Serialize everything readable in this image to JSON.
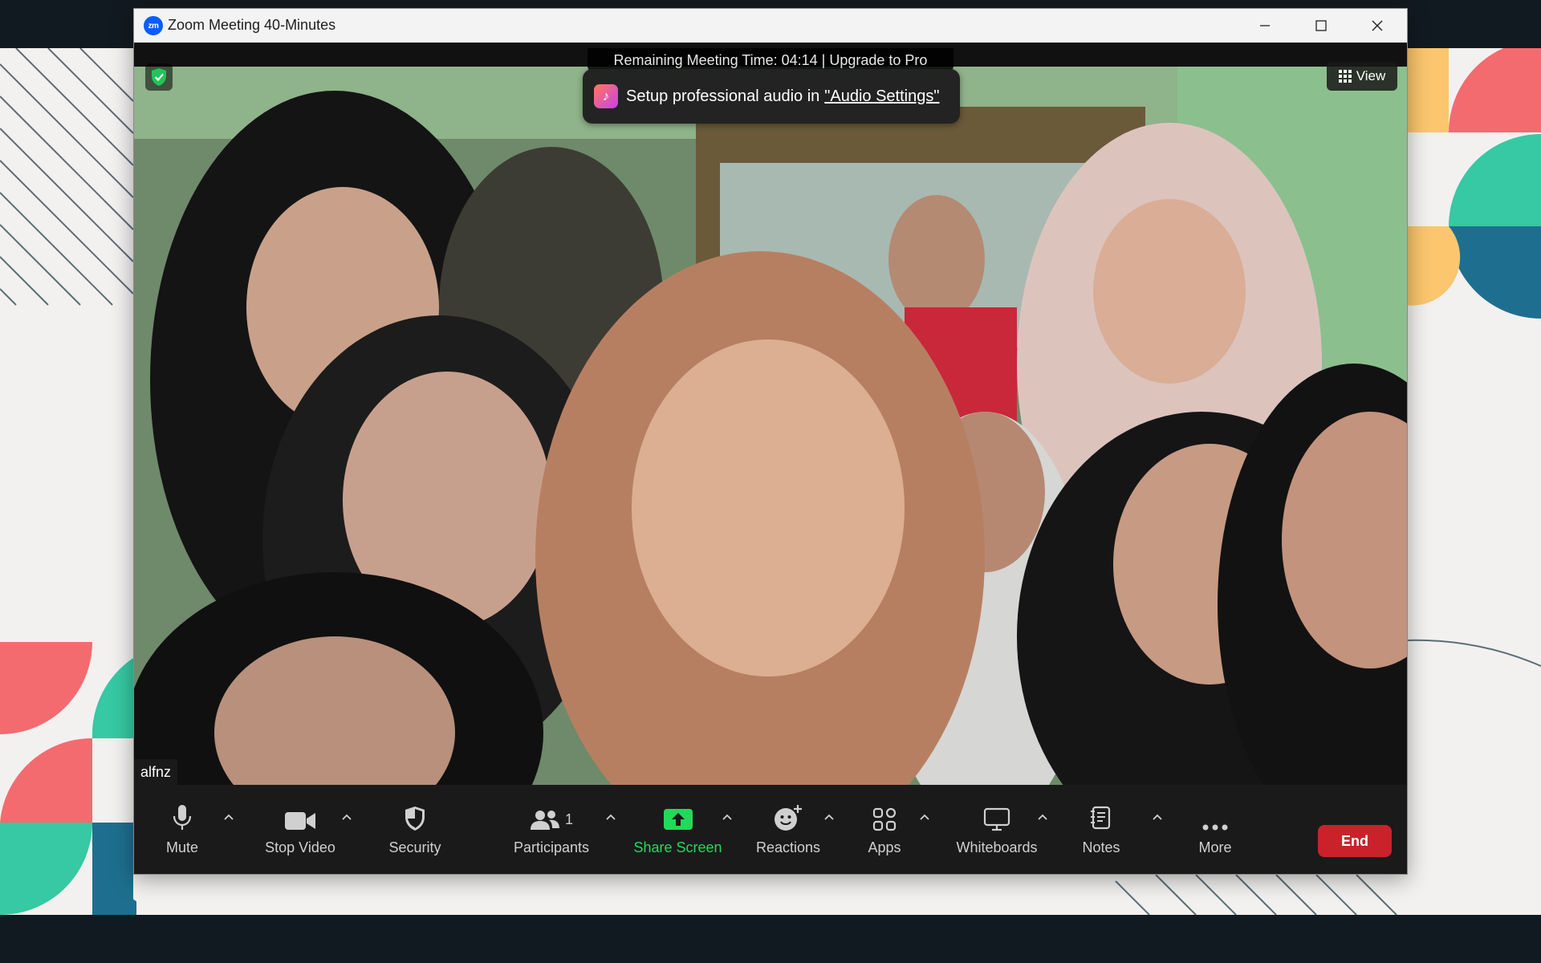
{
  "window": {
    "app_logo": "zm",
    "title": "Zoom Meeting 40-Minutes",
    "controls": [
      "minimize-icon",
      "maximize-icon",
      "close-icon"
    ]
  },
  "meeting": {
    "timer_banner": "Remaining Meeting Time: 04:14 | Upgrade to Pro",
    "toast": {
      "prefix": "Setup professional audio in",
      "link": "\"Audio Settings\"",
      "icon": "music-note-icon"
    },
    "view_label": "View",
    "encryption_icon": "shield-check-icon",
    "participant_name": "alfnz"
  },
  "toolbar": {
    "mute": {
      "label": "Mute",
      "icon": "microphone-icon"
    },
    "stop_video": {
      "label": "Stop Video",
      "icon": "video-camera-icon"
    },
    "security": {
      "label": "Security",
      "icon": "shield-icon"
    },
    "participants": {
      "label": "Participants",
      "count": "1",
      "icon": "participants-icon"
    },
    "share_screen": {
      "label": "Share Screen",
      "icon": "share-screen-icon",
      "color": "#23d959"
    },
    "reactions": {
      "label": "Reactions",
      "icon": "smiley-plus-icon"
    },
    "apps": {
      "label": "Apps",
      "icon": "apps-icon"
    },
    "whiteboards": {
      "label": "Whiteboards",
      "icon": "whiteboard-icon"
    },
    "notes": {
      "label": "Notes",
      "icon": "notes-icon"
    },
    "more": {
      "label": "More",
      "icon": "more-dots-icon"
    },
    "end": {
      "label": "End",
      "color": "#c9222b"
    }
  }
}
